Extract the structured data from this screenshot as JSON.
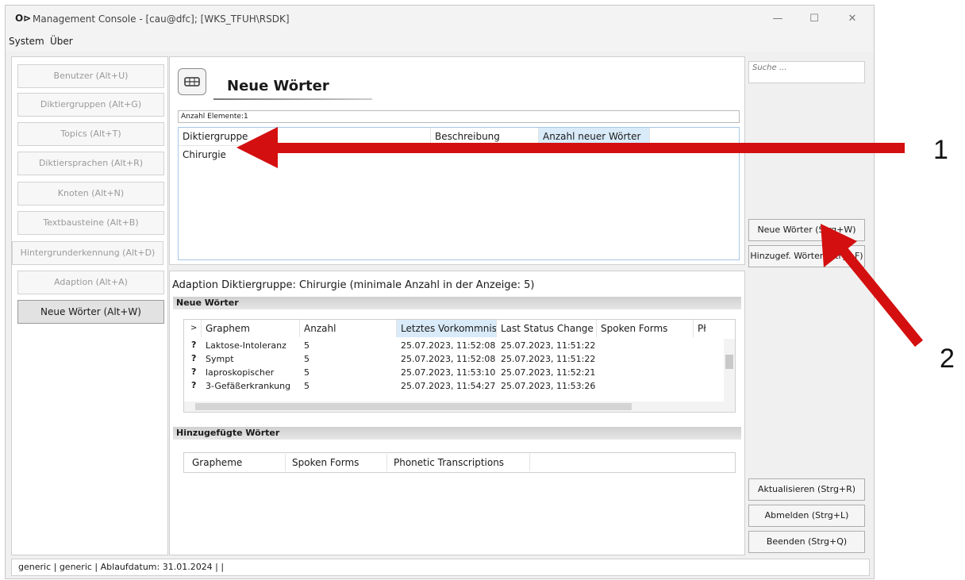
{
  "window": {
    "logo": "O⊳",
    "title": "Management Console - [cau@dfc]; [WKS_TFUH\\RSDK]",
    "minimize": "—",
    "maximize": "☐",
    "close": "✕"
  },
  "menu": [
    "System",
    "Über"
  ],
  "sidebar": {
    "items": [
      {
        "label": "Benutzer (Alt+U)"
      },
      {
        "label": "Diktiergruppen (Alt+G)"
      },
      {
        "label": "Topics (Alt+T)"
      },
      {
        "label": "Diktiersprachen (Alt+R)"
      },
      {
        "label": "Knoten (Alt+N)"
      },
      {
        "label": "Textbausteine (Alt+B)"
      },
      {
        "label": "Hintergrunderkennung (Alt+D)"
      },
      {
        "label": "Adaption (Alt+A)"
      },
      {
        "label": "Neue Wörter (Alt+W)"
      }
    ]
  },
  "header": {
    "icon": "keyboard-icon",
    "title": "Neue Wörter",
    "count_label": "Anzahl Elemente:1"
  },
  "top_grid": {
    "columns": [
      "Diktiergruppe",
      "Beschreibung",
      "Anzahl neuer Wörter"
    ],
    "rows": [
      [
        "Chirurgie",
        "",
        ""
      ]
    ]
  },
  "adaption": {
    "title": "Adaption Diktiergruppe: Chirurgie (minimale Anzahl in der Anzeige: 5)",
    "section_new": "Neue Wörter",
    "section_added": "Hinzugefügte Wörter",
    "new_columns": [
      ">",
      "Graphem",
      "Anzahl",
      "Letztes Vorkommnis",
      "Last Status Change",
      "Spoken Forms",
      "Pł"
    ],
    "new_rows": [
      {
        "mark": "?",
        "graphem": "Laktose-Intoleranz",
        "anzahl": "5",
        "letztes": "25.07.2023, 11:52:08",
        "status": "25.07.2023, 11:51:22"
      },
      {
        "mark": "?",
        "graphem": "Sympt",
        "anzahl": "5",
        "letztes": "25.07.2023, 11:52:08",
        "status": "25.07.2023, 11:51:22"
      },
      {
        "mark": "?",
        "graphem": "laproskopischer",
        "anzahl": "5",
        "letztes": "25.07.2023, 11:53:10",
        "status": "25.07.2023, 11:52:21"
      },
      {
        "mark": "?",
        "graphem": "3-Gefäßerkrankung",
        "anzahl": "5",
        "letztes": "25.07.2023, 11:54:27",
        "status": "25.07.2023, 11:53:26"
      }
    ],
    "added_columns": [
      "Grapheme",
      "Spoken Forms",
      "Phonetic Transcriptions"
    ]
  },
  "right": {
    "search_placeholder": "Suche ...",
    "btn_new": "Neue Wörter (Strg+W)",
    "btn_added": "Hinzugef. Wörter (Strg+F)",
    "btn_refresh": "Aktualisieren (Strg+R)",
    "btn_logout": "Abmelden (Strg+L)",
    "btn_exit": "Beenden (Strg+Q)"
  },
  "status": "generic | generic | Ablaufdatum: 31.01.2024 | |",
  "callouts": [
    "1",
    "2"
  ],
  "colors": {
    "arrow": "#d40f0f",
    "selected_header": "#d9ebf9"
  }
}
